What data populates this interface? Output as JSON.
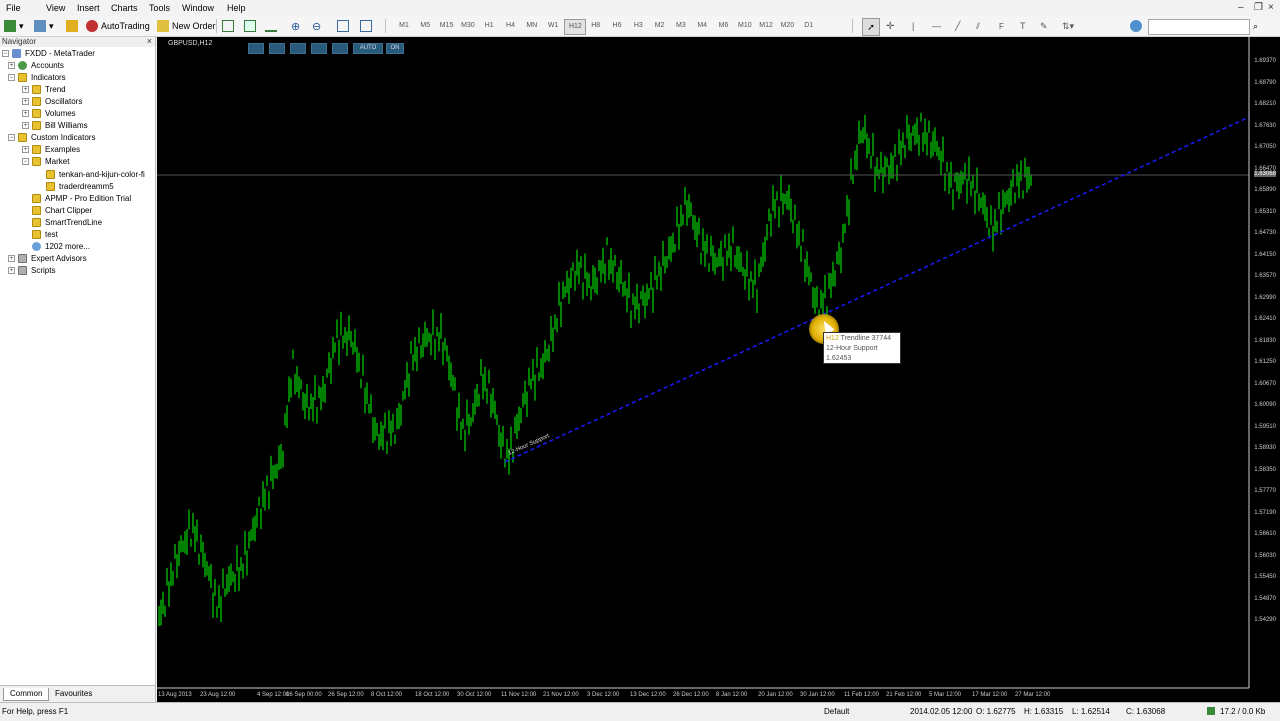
{
  "menu": [
    "File",
    "View",
    "Insert",
    "Charts",
    "Tools",
    "Window",
    "Help"
  ],
  "toolbar": {
    "autotrading": "AutoTrading",
    "new_order": "New Order",
    "timeframes": [
      "M1",
      "M5",
      "M15",
      "M30",
      "H1",
      "H4",
      "MN",
      "W1",
      "H12",
      "H8",
      "H6",
      "H3",
      "M2",
      "M3",
      "M4",
      "M6",
      "M10",
      "M12",
      "M20",
      "D1"
    ],
    "active_timeframe": "H12"
  },
  "navigator": {
    "title": "Navigator",
    "items": [
      {
        "label": "FXDD - MetaTrader",
        "icon": "terminal-icon"
      },
      {
        "label": "Accounts",
        "icon": "accounts-icon"
      },
      {
        "label": "Indicators",
        "icon": "indicators-icon"
      },
      {
        "label": "Trend",
        "icon": "indicator-icon"
      },
      {
        "label": "Oscillators",
        "icon": "indicator-icon"
      },
      {
        "label": "Volumes",
        "icon": "indicator-icon"
      },
      {
        "label": "Bill Williams",
        "icon": "indicator-icon"
      },
      {
        "label": "Custom Indicators",
        "icon": "indicator-icon"
      },
      {
        "label": "Examples",
        "icon": "indicator-icon"
      },
      {
        "label": "Market",
        "icon": "indicator-icon"
      },
      {
        "label": "tenkan-and-kijun-color-fi",
        "icon": "indicator-icon"
      },
      {
        "label": "traderdreamm5",
        "icon": "indicator-icon"
      },
      {
        "label": "APMP - Pro Edition Trial",
        "icon": "indicator-icon"
      },
      {
        "label": "Chart Clipper",
        "icon": "indicator-icon"
      },
      {
        "label": "SmartTrendLine",
        "icon": "indicator-icon"
      },
      {
        "label": "test",
        "icon": "indicator-icon"
      },
      {
        "label": "1202 more...",
        "icon": "more-icon"
      },
      {
        "label": "Expert Advisors",
        "icon": "expert-icon"
      },
      {
        "label": "Scripts",
        "icon": "scripts-icon"
      }
    ],
    "tabs": [
      "Common",
      "Favourites"
    ]
  },
  "chart": {
    "symbol": "GBPUSD,H12",
    "auto_label": "AUTO",
    "on_label": "ON",
    "price_levels": [
      "1.69370",
      "1.68790",
      "1.68210",
      "1.67630",
      "1.67050",
      "1.66470",
      "1.65890",
      "1.65310",
      "1.64730",
      "1.64150",
      "1.63570",
      "1.62990",
      "1.62410",
      "1.61830",
      "1.61250",
      "1.60670",
      "1.60090",
      "1.59510",
      "1.58930",
      "1.58350",
      "1.57770",
      "1.57190",
      "1.56610",
      "1.56030",
      "1.55450",
      "1.54870",
      "1.54290"
    ],
    "current_price": "1.63068",
    "dates": [
      "13 Aug 2013",
      "23 Aug 12:00",
      "4 Sep 12:00",
      "16 Sep 00:00",
      "26 Sep 12:00",
      "8 Oct 12:00",
      "18 Oct 12:00",
      "30 Oct 12:00",
      "11 Nov 12:00",
      "21 Nov 12:00",
      "3 Dec 12:00",
      "13 Dec 12:00",
      "26 Dec 12:00",
      "8 Jan 12:00",
      "20 Jan 12:00",
      "30 Jan 12:00",
      "11 Feb 12:00",
      "21 Feb 12:00",
      "5 Mar 12:00",
      "17 Mar 12:00",
      "27 Mar 12:00"
    ],
    "trendline_label": "12-Hour Support",
    "tooltip": {
      "tf": "H12",
      "line1": "Trendline 37744",
      "line2": "12-Hour Support",
      "line3": "1.62453"
    },
    "colors": {
      "candle": "#00ff00",
      "trendline": "#1a1aff",
      "background": "#000000"
    }
  },
  "status": {
    "help": "For Help, press F1",
    "profile": "Default",
    "datetime": "2014.02.05 12:00",
    "open": "O: 1.62775",
    "high": "H: 1.63315",
    "low": "L: 1.62514",
    "close": "C: 1.63068",
    "traffic": "17.2 / 0.0 Kb"
  }
}
